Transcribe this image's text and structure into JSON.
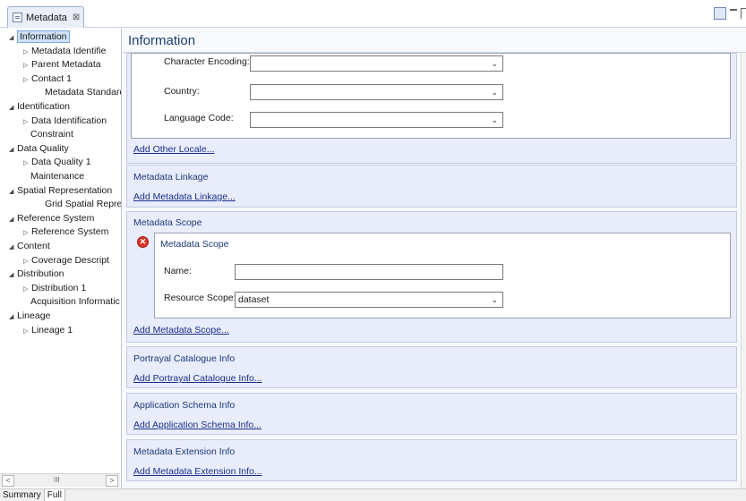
{
  "tab": {
    "title": "Metadata",
    "close": "⊠"
  },
  "tree": {
    "items": [
      {
        "label": "Information",
        "arrow": "◢",
        "indent": 0,
        "selected": true
      },
      {
        "label": "Metadata Identifie",
        "arrow": "▷",
        "indent": 1
      },
      {
        "label": "Parent Metadata",
        "arrow": "▷",
        "indent": 1
      },
      {
        "label": "Contact 1",
        "arrow": "▷",
        "indent": 1
      },
      {
        "label": "Metadata Standard",
        "arrow": "",
        "indent": 1
      },
      {
        "label": "Identification",
        "arrow": "◢",
        "indent": 0
      },
      {
        "label": "Data Identification",
        "arrow": "▷",
        "indent": 1
      },
      {
        "label": "Constraint",
        "arrow": "",
        "indent": 0
      },
      {
        "label": "Data Quality",
        "arrow": "◢",
        "indent": 0
      },
      {
        "label": "Data Quality 1",
        "arrow": "▷",
        "indent": 1
      },
      {
        "label": "Maintenance",
        "arrow": "",
        "indent": 0
      },
      {
        "label": "Spatial Representation",
        "arrow": "◢",
        "indent": 0
      },
      {
        "label": "Grid Spatial Repres",
        "arrow": "",
        "indent": 1
      },
      {
        "label": "Reference System",
        "arrow": "◢",
        "indent": 0
      },
      {
        "label": "Reference System",
        "arrow": "▷",
        "indent": 1
      },
      {
        "label": "Content",
        "arrow": "◢",
        "indent": 0
      },
      {
        "label": "Coverage Descript",
        "arrow": "▷",
        "indent": 1
      },
      {
        "label": "Distribution",
        "arrow": "◢",
        "indent": 0
      },
      {
        "label": "Distribution 1",
        "arrow": "▷",
        "indent": 1
      },
      {
        "label": "Acquisition Informatic",
        "arrow": "",
        "indent": 0
      },
      {
        "label": "Lineage",
        "arrow": "◢",
        "indent": 0
      },
      {
        "label": "Lineage 1",
        "arrow": "▷",
        "indent": 1
      }
    ],
    "hscroll": {
      "left": "<",
      "right": ">",
      "thumb": "III"
    }
  },
  "bottom_tabs": [
    "Summary",
    "Full"
  ],
  "main": {
    "title": "Information",
    "locale": {
      "character_encoding_label": "Character Encoding:",
      "country_label": "Country:",
      "language_code_label": "Language Code:",
      "character_encoding_value": "",
      "country_value": "",
      "language_code_value": "",
      "add_link": "Add Other Locale..."
    },
    "linkage": {
      "title": "Metadata Linkage",
      "add_link": "Add Metadata Linkage..."
    },
    "scope": {
      "title": "Metadata Scope",
      "inner_title": "Metadata Scope",
      "name_label": "Name:",
      "name_value": "",
      "resource_scope_label": "Resource Scope:",
      "resource_scope_value": "dataset",
      "add_link": "Add Metadata Scope..."
    },
    "portrayal": {
      "title": "Portrayal Catalogue Info",
      "add_link": "Add Portrayal Catalogue Info..."
    },
    "app_schema": {
      "title": "Application Schema Info",
      "add_link": "Add Application Schema Info..."
    },
    "extension": {
      "title": "Metadata Extension Info",
      "add_link": "Add Metadata Extension Info..."
    }
  },
  "icons": {
    "chevron": "chevron-down-icon",
    "error": "error-icon",
    "doc": "document-icon"
  }
}
